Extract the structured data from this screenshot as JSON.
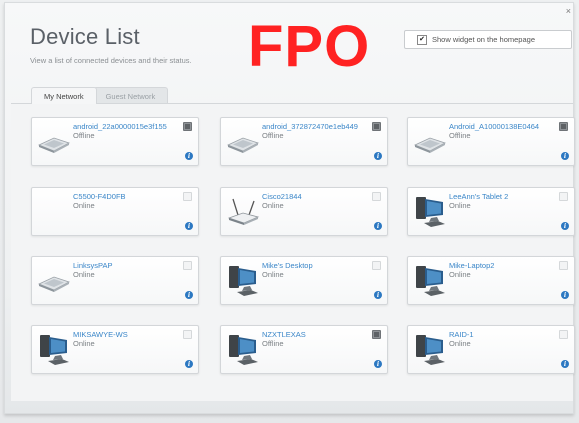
{
  "header": {
    "title": "Device List",
    "subtitle": "View a list of connected devices and their status.",
    "stamp": "FPO",
    "close_glyph": "×"
  },
  "widget": {
    "label": "Show widget on the homepage",
    "checked": true,
    "check_glyph": "✔"
  },
  "tabs": [
    {
      "label": "My Network",
      "active": true
    },
    {
      "label": "Guest Network",
      "active": false
    }
  ],
  "devices": [
    {
      "name": "android_22a0000015e3f155",
      "status": "Offline",
      "icon": "phone-icon",
      "box": "dark"
    },
    {
      "name": "android_372872470e1eb449",
      "status": "Offline",
      "icon": "phone-icon",
      "box": "dark"
    },
    {
      "name": "Android_A10000138E0464",
      "status": "Offline",
      "icon": "phone-icon",
      "box": "dark"
    },
    {
      "name": "C5500-F4D0FB",
      "status": "Online",
      "icon": "generic-icon",
      "box": "light"
    },
    {
      "name": "Cisco21844",
      "status": "Online",
      "icon": "router-icon",
      "box": "light"
    },
    {
      "name": "LeeAnn's Tablet 2",
      "status": "Online",
      "icon": "desktop-icon",
      "box": "light"
    },
    {
      "name": "LinksysPAP",
      "status": "Online",
      "icon": "phone-icon",
      "box": "light"
    },
    {
      "name": "Mike's Desktop",
      "status": "Online",
      "icon": "desktop-icon",
      "box": "light"
    },
    {
      "name": "Mike-Laptop2",
      "status": "Online",
      "icon": "desktop-icon",
      "box": "light"
    },
    {
      "name": "MIKSAWYE-WS",
      "status": "Online",
      "icon": "desktop-icon",
      "box": "light"
    },
    {
      "name": "NZXTLEXAS",
      "status": "Offline",
      "icon": "desktop-icon",
      "box": "dark"
    },
    {
      "name": "RAID-1",
      "status": "Online",
      "icon": "desktop-icon",
      "box": "light"
    }
  ],
  "info_glyph": "i",
  "colors": {
    "link": "#3a86c8",
    "stamp": "#ff2222",
    "info": "#2c78c2"
  }
}
